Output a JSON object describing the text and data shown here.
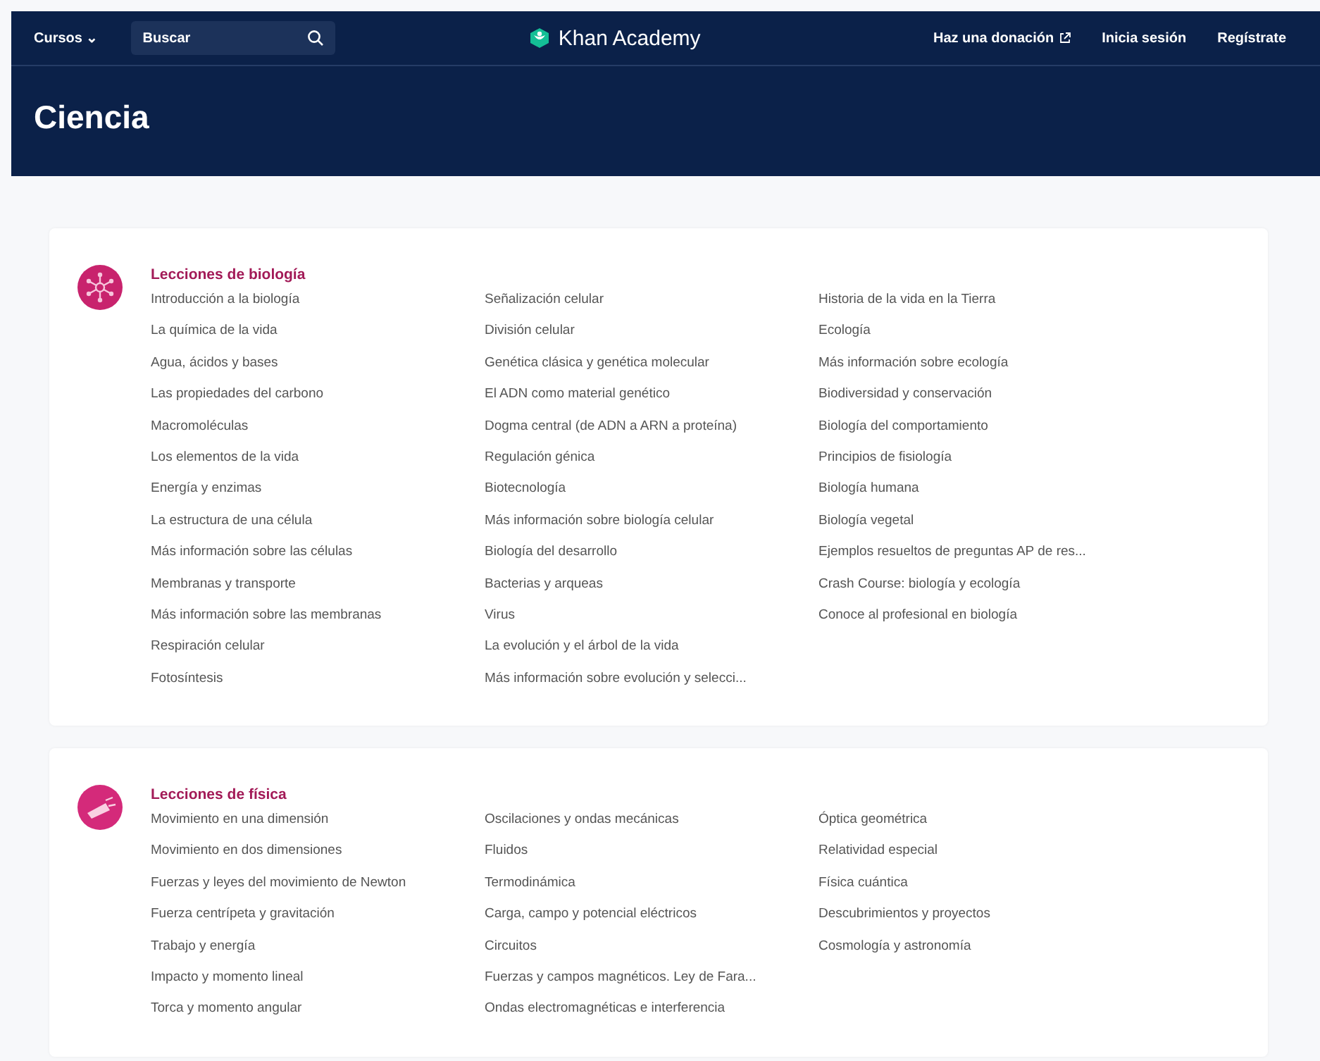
{
  "nav": {
    "courses": "Cursos",
    "courses_caret": "⌄",
    "search": {
      "placeholder": "Buscar"
    },
    "logo": "Khan Academy",
    "links": [
      {
        "label": "Haz una donación",
        "external": true
      },
      {
        "label": "Inicia sesión",
        "external": false
      },
      {
        "label": "Regístrate",
        "external": false
      }
    ]
  },
  "header": {
    "title": "Ciencia"
  },
  "sections": [
    {
      "kind": "biology",
      "title": "Lecciones de biología",
      "columns": [
        [
          "Introducción a la biología",
          "La química de la vida",
          "Agua, ácidos y bases",
          "Las propiedades del carbono",
          "Macromoléculas",
          "Los elementos de la vida",
          "Energía y enzimas",
          "La estructura de una célula",
          "Más información sobre las células",
          "Membranas y transporte",
          "Más información sobre las membranas",
          "Respiración celular",
          "Fotosíntesis"
        ],
        [
          "Señalización celular",
          "División celular",
          "Genética clásica y genética molecular",
          "El ADN como material genético",
          "Dogma central (de ADN a ARN a proteína)",
          "Regulación génica",
          "Biotecnología",
          "Más información sobre biología celular",
          "Biología del desarrollo",
          "Bacterias y arqueas",
          "Virus",
          "La evolución y el árbol de la vida",
          "Más información sobre evolución y selecci..."
        ],
        [
          "Historia de la vida en la Tierra",
          "Ecología",
          "Más información sobre ecología",
          "Biodiversidad y conservación",
          "Biología del comportamiento",
          "Principios de fisiología",
          "Biología humana",
          "Biología vegetal",
          "Ejemplos resueltos de preguntas AP de res...",
          "Crash Course: biología y ecología",
          "Conoce al profesional en biología"
        ]
      ]
    },
    {
      "kind": "physics",
      "title": "Lecciones de física",
      "columns": [
        [
          "Movimiento en una dimensión",
          "Movimiento en dos dimensiones",
          "Fuerzas y leyes del movimiento de Newton",
          "Fuerza centrípeta y gravitación",
          "Trabajo y energía",
          "Impacto y momento lineal",
          "Torca y momento angular"
        ],
        [
          "Oscilaciones y ondas mecánicas",
          "Fluidos",
          "Termodinámica",
          "Carga, campo y potencial eléctricos",
          "Circuitos",
          "Fuerzas y campos magnéticos. Ley de Fara...",
          "Ondas electromagnéticas e interferencia"
        ],
        [
          "Óptica geométrica",
          "Relatividad especial",
          "Física cuántica",
          "Descubrimientos y proyectos",
          "Cosmología y astronomía"
        ]
      ]
    }
  ]
}
